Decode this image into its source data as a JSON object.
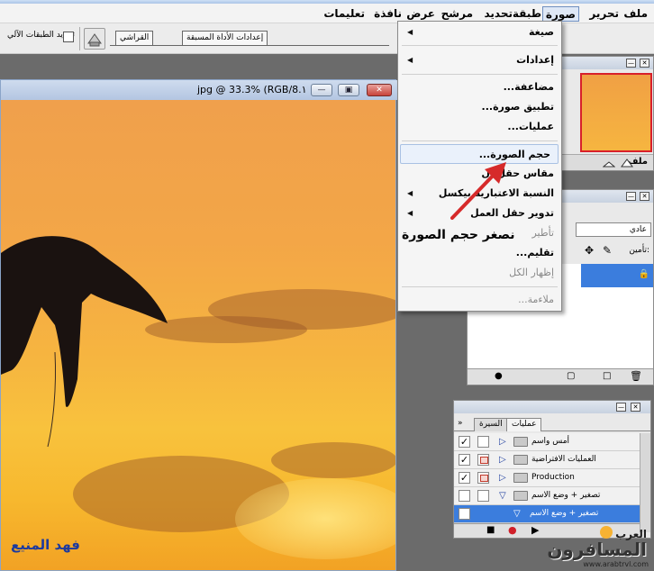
{
  "menubar": {
    "items": [
      "ملف",
      "تحرير",
      "صورة",
      "طبقة",
      "تحديد",
      "مرشح",
      "عرض",
      "نافذة",
      "تعليمات"
    ],
    "active": "صورة"
  },
  "options_bar": {
    "checkbox_label": "تحديد الطبقات الآلي",
    "tabs": [
      "إعدادات الأداة المسبقة",
      "القراشي"
    ]
  },
  "document": {
    "title": "jpg @ 33.3% (RGB/8.١",
    "watermark": "فهد المنيع"
  },
  "image_menu": {
    "items": [
      {
        "label": "صيغة",
        "submenu": true,
        "disabled": false
      },
      {
        "label": "إعدادات",
        "submenu": true,
        "disabled": false
      },
      {
        "label": "مضاعفة...",
        "submenu": false,
        "disabled": false
      },
      {
        "label": "تطبيق صورة...",
        "submenu": false,
        "disabled": false
      },
      {
        "label": "عمليات...",
        "submenu": false,
        "disabled": false
      },
      {
        "label": "حجم الصورة...",
        "submenu": false,
        "disabled": false,
        "highlighted": true
      },
      {
        "label": "مقاس حقل ال",
        "submenu": false,
        "disabled": false
      },
      {
        "label": "النسبة الاعتبارية بيكسل",
        "submenu": true,
        "disabled": false
      },
      {
        "label": "تدوير حقل العمل",
        "submenu": true,
        "disabled": false
      },
      {
        "label": "تأطير",
        "submenu": false,
        "disabled": true
      },
      {
        "label": "تقليم...",
        "submenu": false,
        "disabled": false
      },
      {
        "label": "إظهار الكل",
        "submenu": false,
        "disabled": true
      },
      {
        "label": "ملاءمة...",
        "submenu": false,
        "disabled": true
      }
    ]
  },
  "annotation": {
    "text": "نصغر حجم الصورة",
    "arrow_color": "#d62a2a"
  },
  "layers_panel": {
    "blend_mode": "عادي",
    "lock_label": "تأمين:"
  },
  "actions_panel": {
    "tabs": [
      "عمليات",
      "السيرة"
    ],
    "rows": [
      {
        "label": "أمس واسم",
        "checked": true,
        "dialog": false,
        "expanded": false
      },
      {
        "label": "العمليات الافتراضية",
        "checked": true,
        "dialog": true,
        "expanded": false
      },
      {
        "label": "Production",
        "checked": true,
        "dialog": true,
        "expanded": false
      },
      {
        "label": "تصغير + وضع الاسم",
        "checked": false,
        "dialog": false,
        "expanded": true
      },
      {
        "label": "تصغير + وضع الاسم",
        "checked": false,
        "dialog": false,
        "expanded": true,
        "selected": true
      }
    ]
  },
  "site_logo": {
    "line1": "العرب",
    "line2": "المسافرون",
    "url": "www.arabtrvl.com"
  }
}
